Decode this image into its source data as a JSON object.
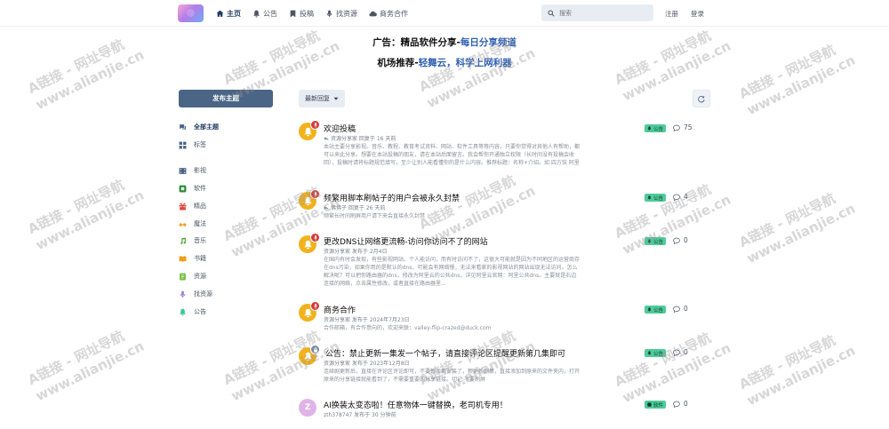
{
  "header": {
    "nav": [
      {
        "label": "主页",
        "icon": "home-icon"
      },
      {
        "label": "公告",
        "icon": "bell-icon"
      },
      {
        "label": "投稿",
        "icon": "bookmark-icon"
      },
      {
        "label": "找资源",
        "icon": "mic-icon"
      },
      {
        "label": "商务合作",
        "icon": "cloud-icon"
      }
    ],
    "search_placeholder": "搜索",
    "register": "注册",
    "login": "登录"
  },
  "ad": {
    "line1_prefix": "广告：精品软件分享-",
    "line1_link": "每日分享频道",
    "line2_prefix": "机场推荐-",
    "line2_link": "轻舞云，科学上网利器"
  },
  "sidebar": {
    "post_button": "发布主题",
    "items": [
      {
        "label": "全部主题",
        "icon": "comments-icon",
        "color": "#1e3a5f"
      },
      {
        "label": "标签",
        "icon": "grid-icon",
        "color": "#4a6586"
      },
      {
        "label": "影视",
        "icon": "film-icon",
        "color": "#4a6586"
      },
      {
        "label": "软件",
        "icon": "app-icon",
        "color": "#2f8f3a"
      },
      {
        "label": "精品",
        "icon": "gift-icon",
        "color": "#e0473a"
      },
      {
        "label": "魔法",
        "icon": "glasses-icon",
        "color": "#f29d1c"
      },
      {
        "label": "音乐",
        "icon": "music-icon",
        "color": "#4aa33a"
      },
      {
        "label": "书籍",
        "icon": "book-icon",
        "color": "#f29d1c"
      },
      {
        "label": "资源",
        "icon": "folder-icon",
        "color": "#6fbf3a"
      },
      {
        "label": "找资源",
        "icon": "mic-icon",
        "color": "#9e7fd6"
      },
      {
        "label": "公告",
        "icon": "bell-icon",
        "color": "#3fc79a"
      }
    ]
  },
  "toolbar": {
    "sort_label": "最新回复"
  },
  "topics": [
    {
      "title": "欢迎投稿",
      "meta": "资源分享家 回复于 16 天前",
      "excerpt": "本站主要分享影视、音乐、教程、教育考试资料、网站、软件工具等等内容，只要你觉得对其他人有帮助，都可以来此分享。想要在本站投稿的朋友，请在本站后面留言。我会帮你开通独立权限（长时间没有投稿会收回），投稿时请将标题规范填写，至少让别人能看懂你的是什么内容。推荐标题：名称+介绍。如 四方馆 阿里云盘 更新27.4k画质 任何影视都能秒播不卡顿从 观...",
      "tag": "公告",
      "replies": "75",
      "reply_icon": true
    },
    {
      "title": "频繁用脚本刷帖子的用户会被永久封禁",
      "meta": "佛佛子 回复于 26 天前",
      "excerpt": "频繁长时间刷屏用户请下来会直接永久封禁",
      "tag": "公告",
      "replies": "4",
      "reply_icon": true
    },
    {
      "title": "更改DNS让网络更流畅-访问你访问不了的网站",
      "meta": "资源分享家 发布于 2月4日",
      "excerpt": "在国内有时会发现，有些影视网站、个人能访问，而有时访问不了，这很大可能就是因为不同地区的运营商存在dns污染，如果你用的是默认的dns，可能会有网络慢，无法来看家的影视网站的网站出现无法访问。怎么解决呢？可以把你路由器的dns，修改为阿里云的公共dns，详见阿里云官网：阿里公共dns。主要就是右边连接的网络，点击属性修改，或者直接在路由器里...",
      "tag": "公告",
      "replies": "0",
      "reply_icon": true
    },
    {
      "title": "商务合作",
      "meta": "资源分享家 发布于 2024年7月23日",
      "excerpt": "合作邮箱，有合作意向的，欢迎来联：valley-flip-crazed@duck.com",
      "tag": "公告",
      "replies": "0",
      "reply_icon": true
    },
    {
      "title": "公告：禁止更新一集发一个帖子，请直接评论区提醒更新第几集即可",
      "meta": "资源分享家 发布于 2023年12月8日",
      "excerpt": "连续剧更新后，直接在评论区评论即可，不要每次都安装了，新更新剧集，直接添加到原来的文件夹内，打开原来的分享链接就能看到了，不需要重要的分享链接。切记:不要刷屏",
      "tag": "公告",
      "replies": "0",
      "reply_icon": true
    },
    {
      "title": "AI换装太变态啦！任意物体一键替换，老司机专用！",
      "meta": "zth378747 发布于 30 分钟前",
      "excerpt": "",
      "tag": "软件",
      "replies": "0",
      "reply_icon": true
    }
  ],
  "watermarks": {
    "line1": "A链接 - 网址导航",
    "line2": "www.alianjie.cn"
  },
  "colors": {
    "primary": "#4a6586",
    "tag_green": "#4ecb9a",
    "pin_red": "#d63b3b",
    "avatar_yellow": "#f2b21c",
    "link_blue": "#2f5fb3"
  }
}
